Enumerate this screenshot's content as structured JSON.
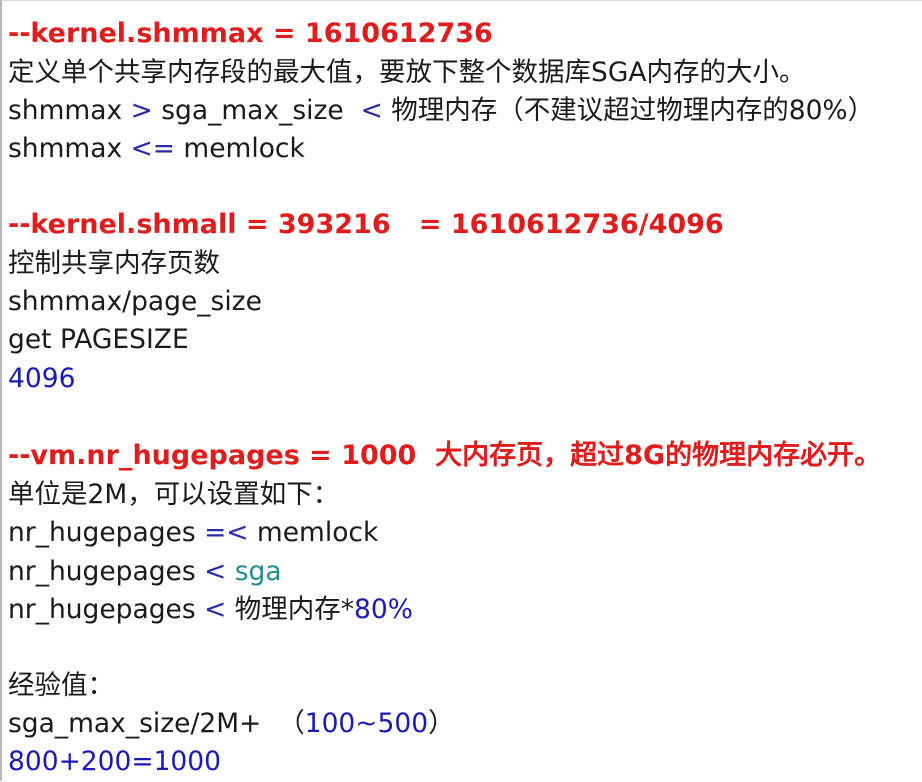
{
  "s1": {
    "heading": "--kernel.shmmax = 1610612736",
    "lines": [
      "定义单个共享内存段的最大值，要放下整个数据库SGA内存的大小。",
      {
        "a": "shmmax ",
        "b": ">",
        "c": " sga_max_size  ",
        "d": "<",
        "e": " 物理内存（不建议超过物理内存的80%）"
      },
      {
        "a": "shmmax ",
        "b": "<=",
        "c": " memlock"
      }
    ]
  },
  "s2": {
    "heading": "--kernel.shmall = 393216   = 1610612736/4096",
    "lines": [
      "控制共享内存页数",
      "shmmax/page_size",
      "get PAGESIZE",
      "4096"
    ]
  },
  "s3": {
    "heading": "--vm.nr_hugepages = 1000  大内存页，超过8G的物理内存必开。",
    "lines": [
      "单位是2M，可以设置如下：",
      {
        "a": "nr_hugepages ",
        "b": "=<",
        "c": " memlock"
      },
      {
        "a": "nr_hugepages ",
        "b": "<",
        "c": " sga"
      },
      {
        "a": "nr_hugepages ",
        "b": "<",
        "c": " 物理内存*",
        "d": "80%"
      }
    ]
  },
  "s4": {
    "lines": [
      "经验值：",
      {
        "a": "sga_max_size/2M+  （",
        "b": "100~500",
        "c": "）"
      },
      "800+200=1000"
    ]
  }
}
